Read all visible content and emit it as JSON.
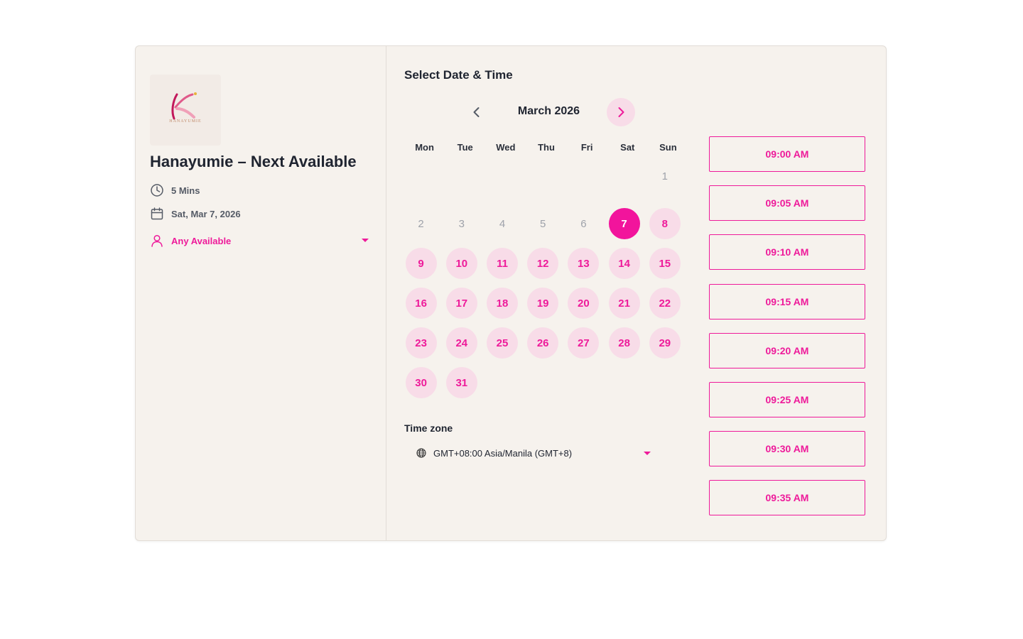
{
  "brand": {
    "accent": "#ee1a9a",
    "accent_light": "#f8dce8",
    "background": "#f6f2ed"
  },
  "sidebar": {
    "logo_text": "HANAYUMIE",
    "service_title": "Hanayumie – Next Available",
    "duration": "5 Mins",
    "date": "Sat, Mar 7, 2026",
    "staff": "Any Available",
    "icons": {
      "duration": "clock-icon",
      "date": "calendar-icon",
      "staff": "user-icon",
      "staff_dropdown": "caret-down-icon"
    }
  },
  "calendar": {
    "section_title": "Select Date & Time",
    "month_label": "March 2026",
    "prev_icon": "chevron-left-icon",
    "next_icon": "chevron-right-icon",
    "weekdays": [
      "Mon",
      "Tue",
      "Wed",
      "Thu",
      "Fri",
      "Sat",
      "Sun"
    ],
    "first_weekday_index": 6,
    "days_in_month": 31,
    "selected_day": 7,
    "past_days": [
      1,
      2,
      3,
      4,
      5,
      6
    ]
  },
  "timezone": {
    "label": "Time zone",
    "value": "GMT+08:00 Asia/Manila (GMT+8)",
    "icon": "globe-icon"
  },
  "time_slots": [
    "09:00 AM",
    "09:05 AM",
    "09:10 AM",
    "09:15 AM",
    "09:20 AM",
    "09:25 AM",
    "09:30 AM",
    "09:35 AM"
  ]
}
